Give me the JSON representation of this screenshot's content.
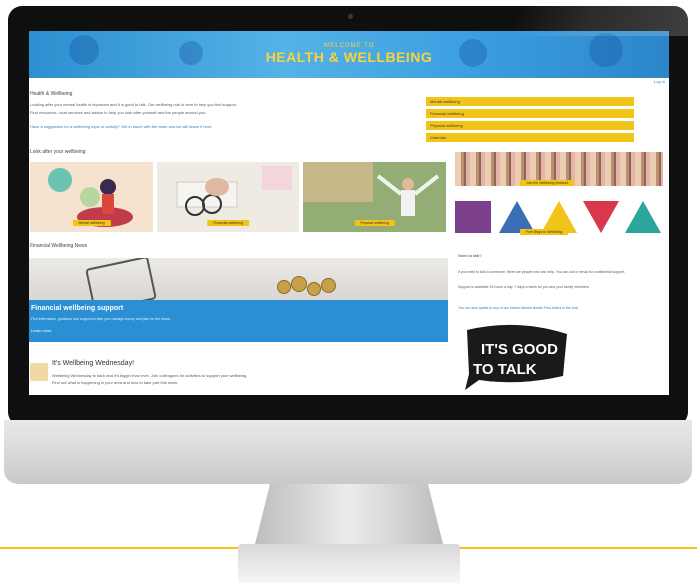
{
  "banner": {
    "subtitle": "WELCOME TO",
    "title": "HEALTH & WELLBEING"
  },
  "top_link": "Log in",
  "intro": {
    "heading": "Health & Wellbeing",
    "lines": [
      "Looking after your mental health is important and it is good to talk. Our wellbeing hub is here to help you find support.",
      "Find resources, local services and advice to help you look after yourself and the people around you.",
      "Have a suggestion for a wellbeing topic or activity? Get in touch with the team and we will share it here."
    ]
  },
  "cards": {
    "heading": "Look after your wellbeing",
    "items": [
      {
        "label": "Mental wellbeing"
      },
      {
        "label": "Financial wellbeing"
      },
      {
        "label": "Physical wellbeing"
      }
    ]
  },
  "section2_heading": "Financial Wellbeing News",
  "support": {
    "title": "Financial wellbeing support",
    "text": "Find information, guidance and support to help you manage money and plan for the future.",
    "link": "Learn more"
  },
  "post": {
    "title": "It's Wellbeing Wednesday!",
    "lines": [
      "Wellbeing Wednesday is back and it's bigger than ever. Join colleagues for activities to support your wellbeing.",
      "Find out what is happening in your area and how to take part this week."
    ]
  },
  "side_links": [
    {
      "label": "Mental wellbeing"
    },
    {
      "label": "Financial wellbeing"
    },
    {
      "label": "Physical wellbeing"
    },
    {
      "label": "Calendar"
    }
  ],
  "side_buttons": {
    "crowd": "Join the Wellbeing Network",
    "shapes": "Five Ways to Wellbeing"
  },
  "need_support": {
    "heading": "Need to talk?",
    "lines": [
      "If you need to talk to someone, there are people who can help. You can call or email for confidential support.",
      "Support is available 24 hours a day, 7 days a week for you and your family members.",
      "You can also speak to any of our trained Mental Health First Aiders in the hub."
    ]
  },
  "talk_logo": "IT'S GOOD TO TALK",
  "colors": {
    "accent_yellow": "#f2c417",
    "banner_blue": "#2a8fd3"
  }
}
